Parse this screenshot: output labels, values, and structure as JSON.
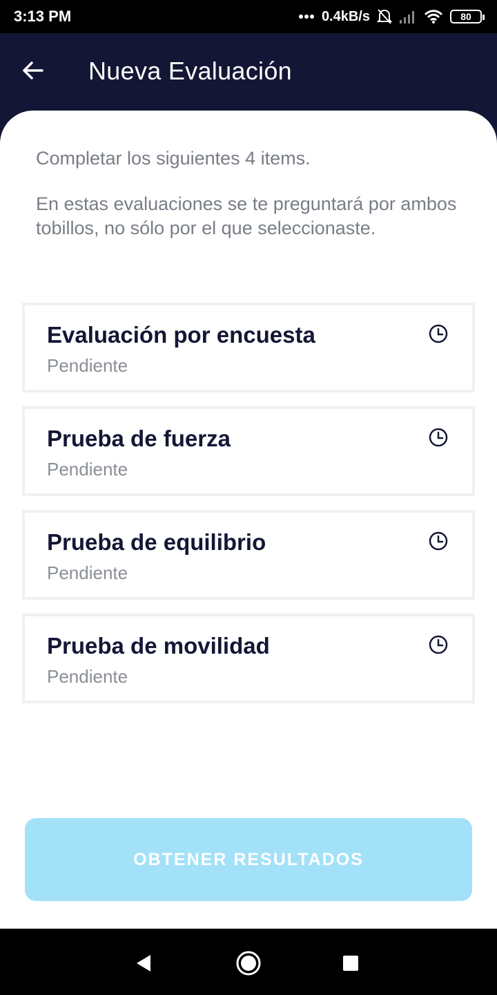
{
  "status_bar": {
    "time": "3:13 PM",
    "network_speed": "0.4kB/s",
    "battery": "80",
    "icons": [
      "dots-icon",
      "bell-muted-icon",
      "signal-icon",
      "wifi-icon",
      "battery-icon"
    ]
  },
  "header": {
    "title": "Nueva Evaluación",
    "back_icon": "arrow-left-icon"
  },
  "intro": {
    "line1": "Completar los siguientes 4 items.",
    "line2": "En estas evaluaciones se te preguntará por ambos tobillos, no sólo por el que seleccionaste."
  },
  "items": [
    {
      "title": "Evaluación por encuesta",
      "status": "Pendiente",
      "icon": "clock-icon"
    },
    {
      "title": "Prueba de fuerza",
      "status": "Pendiente",
      "icon": "clock-icon"
    },
    {
      "title": "Prueba de equilibrio",
      "status": "Pendiente",
      "icon": "clock-icon"
    },
    {
      "title": "Prueba de movilidad",
      "status": "Pendiente",
      "icon": "clock-icon"
    }
  ],
  "footer": {
    "results_label": "OBTENER RESULTADOS"
  },
  "nav": {
    "icons": [
      "back-triangle-icon",
      "home-circle-icon",
      "recents-square-icon"
    ]
  },
  "colors": {
    "header_bg": "#131634",
    "button_bg": "#a3e1f9",
    "title_text": "#131634",
    "muted_text": "#787d86"
  }
}
